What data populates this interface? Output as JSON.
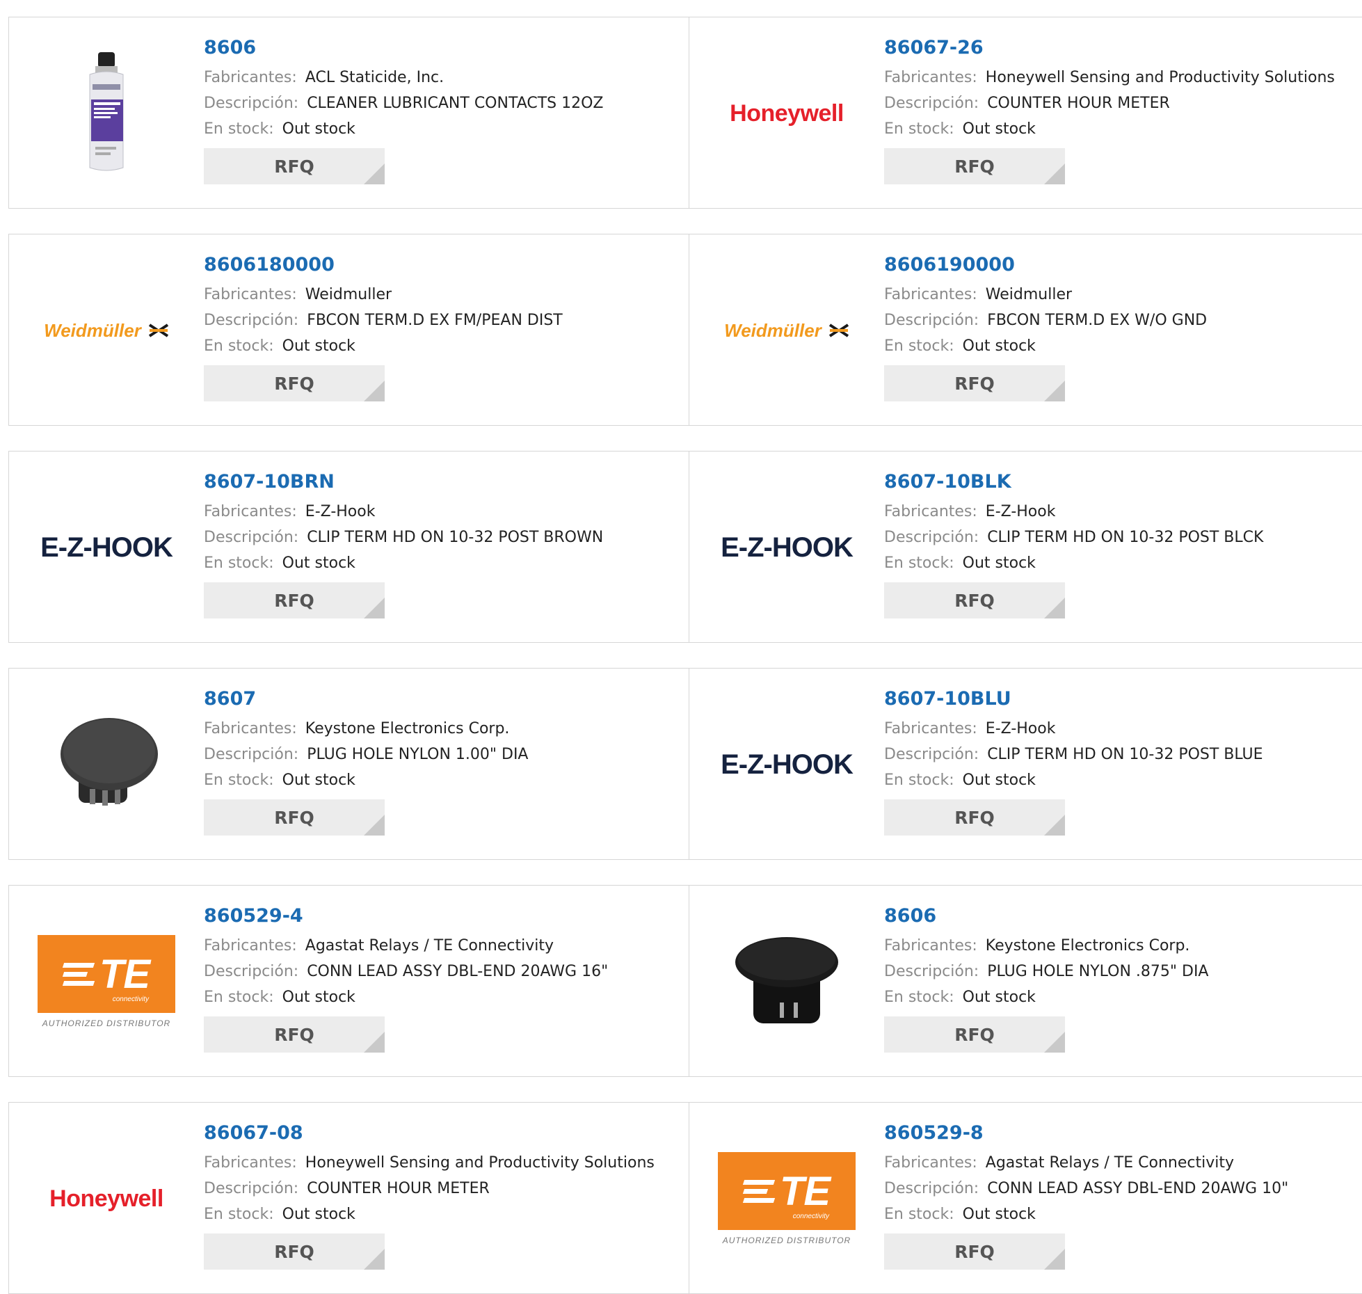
{
  "labels": {
    "manufacturer": "Fabricantes:",
    "description": "Descripción:",
    "stock": "En stock:",
    "rfq": "RFQ"
  },
  "logos": {
    "honeywell": "Honeywell",
    "weidmuller": "Weidmüller",
    "ezhook": "E-Z-HOOK",
    "te": "TE",
    "te_sub": "connectivity",
    "te_authorized": "AUTHORIZED DISTRIBUTOR"
  },
  "colors": {
    "part_link": "#1b6bb2",
    "label": "#8a8a8a",
    "rfq_bg": "#ececec",
    "honeywell_red": "#e5202a",
    "weidmuller_orange": "#f29a1e",
    "te_orange": "#f2841f",
    "ezhook_navy": "#15223f"
  },
  "products": [
    {
      "part": "8606",
      "manufacturer": "ACL Staticide, Inc.",
      "description": "CLEANER LUBRICANT CONTACTS 12OZ",
      "stock": "Out stock",
      "image": "spray-can-image"
    },
    {
      "part": "86067-26",
      "manufacturer": "Honeywell Sensing and Productivity Solutions",
      "description": "COUNTER HOUR METER",
      "stock": "Out stock",
      "image": "honeywell-logo"
    },
    {
      "part": "8606180000",
      "manufacturer": "Weidmuller",
      "description": "FBCON TERM.D EX FM/PEAN DIST",
      "stock": "Out stock",
      "image": "weidmuller-logo"
    },
    {
      "part": "8606190000",
      "manufacturer": "Weidmuller",
      "description": "FBCON TERM.D EX W/O GND",
      "stock": "Out stock",
      "image": "weidmuller-logo"
    },
    {
      "part": "8607-10BRN",
      "manufacturer": "E-Z-Hook",
      "description": "CLIP TERM HD ON 10-32 POST BROWN",
      "stock": "Out stock",
      "image": "ezhook-logo"
    },
    {
      "part": "8607-10BLK",
      "manufacturer": "E-Z-Hook",
      "description": "CLIP TERM HD ON 10-32 POST BLCK",
      "stock": "Out stock",
      "image": "ezhook-logo"
    },
    {
      "part": "8607",
      "manufacturer": "Keystone Electronics Corp.",
      "description": "PLUG HOLE NYLON 1.00\" DIA",
      "stock": "Out stock",
      "image": "hole-plug-grey-image"
    },
    {
      "part": "8607-10BLU",
      "manufacturer": "E-Z-Hook",
      "description": "CLIP TERM HD ON 10-32 POST BLUE",
      "stock": "Out stock",
      "image": "ezhook-logo"
    },
    {
      "part": "860529-4",
      "manufacturer": "Agastat Relays / TE Connectivity",
      "description": "CONN LEAD ASSY DBL-END 20AWG 16\"",
      "stock": "Out stock",
      "image": "te-logo"
    },
    {
      "part": "8606",
      "manufacturer": "Keystone Electronics Corp.",
      "description": "PLUG HOLE NYLON .875\" DIA",
      "stock": "Out stock",
      "image": "hole-plug-black-image"
    },
    {
      "part": "86067-08",
      "manufacturer": "Honeywell Sensing and Productivity Solutions",
      "description": "COUNTER HOUR METER",
      "stock": "Out stock",
      "image": "honeywell-logo"
    },
    {
      "part": "860529-8",
      "manufacturer": "Agastat Relays / TE Connectivity",
      "description": "CONN LEAD ASSY DBL-END 20AWG 10\"",
      "stock": "Out stock",
      "image": "te-logo"
    }
  ]
}
